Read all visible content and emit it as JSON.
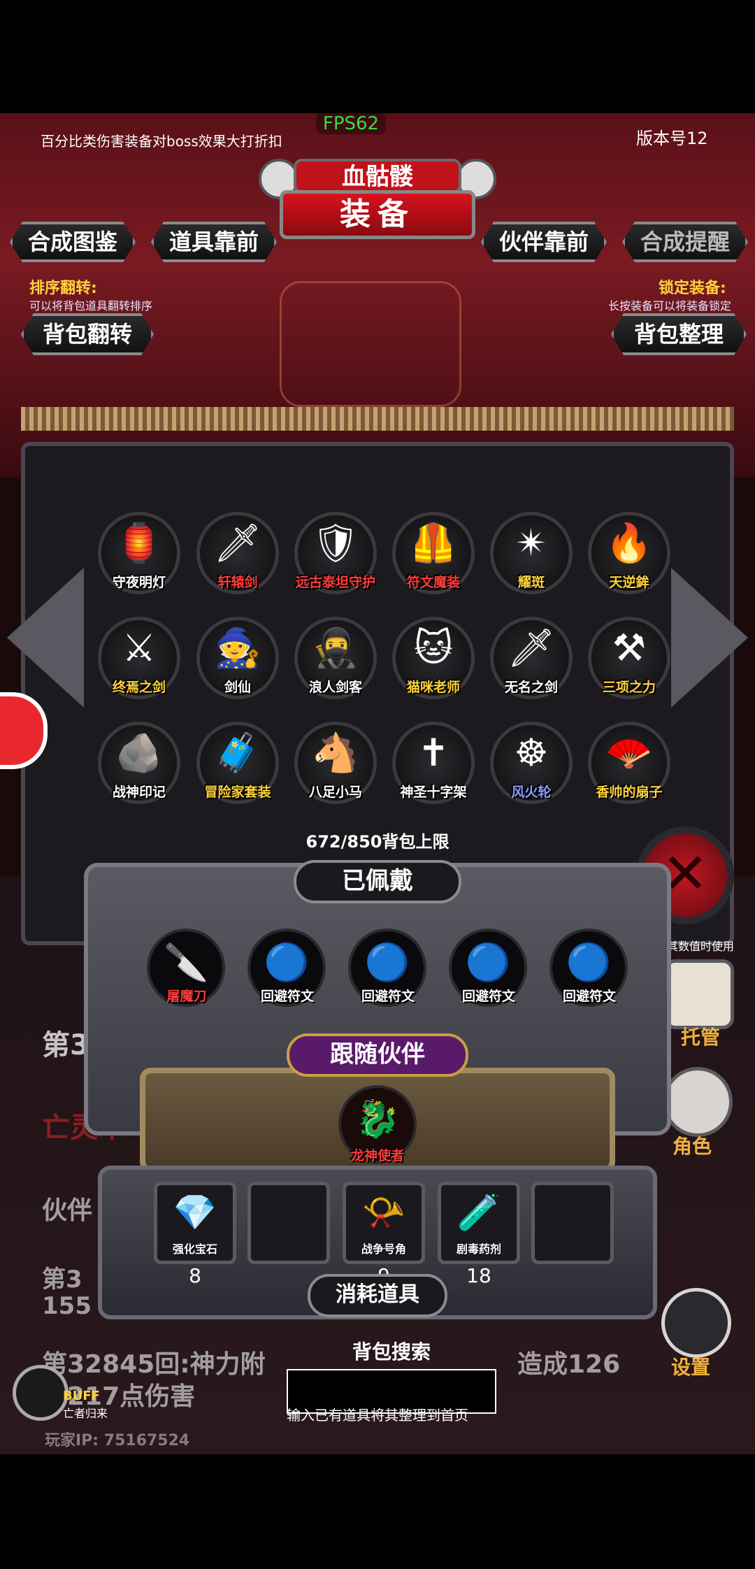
{
  "status_bar": {
    "notice": "百分比类伤害装备对boss效果大打折扣",
    "fps": "FPS62",
    "version": "版本号12"
  },
  "header": {
    "subtitle": "血骷髅",
    "title": "装备"
  },
  "tabs": {
    "synthesis_catalog": "合成图鉴",
    "items_first": "道具靠前",
    "partner_first": "伙伴靠前",
    "synthesis_hint": "合成提醒"
  },
  "controls": {
    "sort_flip_title": "排序翻转:",
    "sort_flip_desc": "可以将背包道具翻转排序",
    "bag_flip_button": "背包翻转",
    "lock_title": "锁定装备:",
    "lock_desc": "长按装备可以将装备锁定",
    "bag_sort_button": "背包整理"
  },
  "inventory": {
    "items": [
      {
        "label": "守夜明灯",
        "color": "#ffffff",
        "icon": "lantern-icon",
        "glyph": "🏮"
      },
      {
        "label": "轩辕剑",
        "color": "#ff3a3a",
        "icon": "sword-icon",
        "glyph": "🗡"
      },
      {
        "label": "远古泰坦守护",
        "color": "#ff3a3a",
        "icon": "titan-icon",
        "glyph": "🛡"
      },
      {
        "label": "符文魔装",
        "color": "#ff3a3a",
        "icon": "rune-armor-icon",
        "glyph": "🦺"
      },
      {
        "label": "耀斑",
        "color": "#ffd23a",
        "icon": "flare-icon",
        "glyph": "✴"
      },
      {
        "label": "天逆鉾",
        "color": "#ffd23a",
        "icon": "spear-icon",
        "glyph": "🔥"
      },
      {
        "label": "终焉之剑",
        "color": "#ffd23a",
        "icon": "finale-sword-icon",
        "glyph": "⚔"
      },
      {
        "label": "剑仙",
        "color": "#ffffff",
        "icon": "sword-immortal-icon",
        "glyph": "🧙"
      },
      {
        "label": "浪人剑客",
        "color": "#ffffff",
        "icon": "ronin-icon",
        "glyph": "🥷"
      },
      {
        "label": "猫咪老师",
        "color": "#ffd23a",
        "icon": "cat-teacher-icon",
        "glyph": "🐱"
      },
      {
        "label": "无名之剑",
        "color": "#ffffff",
        "icon": "nameless-sword-icon",
        "glyph": "🗡"
      },
      {
        "label": "三项之力",
        "color": "#ffd23a",
        "icon": "triforce-icon",
        "glyph": "⚒"
      },
      {
        "label": "战神印记",
        "color": "#ffffff",
        "icon": "war-god-mark-icon",
        "glyph": "🪨"
      },
      {
        "label": "冒险家套装",
        "color": "#ffd23a",
        "icon": "adventurer-icon",
        "glyph": "🧳"
      },
      {
        "label": "八足小马",
        "color": "#ffffff",
        "icon": "horse-icon",
        "glyph": "🐴"
      },
      {
        "label": "神圣十字架",
        "color": "#ffffff",
        "icon": "cross-icon",
        "glyph": "✝"
      },
      {
        "label": "风火轮",
        "color": "#8a9aff",
        "icon": "wind-fire-wheel-icon",
        "glyph": "☸"
      },
      {
        "label": "香帅的扇子",
        "color": "#ffd23a",
        "icon": "fan-icon",
        "glyph": "🪭"
      }
    ],
    "capacity": "672/850背包上限"
  },
  "equipped": {
    "title": "已佩戴",
    "slots": [
      {
        "label": "屠魔刀",
        "color": "#ff3a3a",
        "icon": "blade-icon",
        "glyph": "🔪"
      },
      {
        "label": "回避符文",
        "color": "#ffffff",
        "icon": "evasion-rune-icon",
        "glyph": "🔵"
      },
      {
        "label": "回避符文",
        "color": "#ffffff",
        "icon": "evasion-rune-icon",
        "glyph": "🔵"
      },
      {
        "label": "回避符文",
        "color": "#ffffff",
        "icon": "evasion-rune-icon",
        "glyph": "🔵"
      },
      {
        "label": "回避符文",
        "color": "#ffffff",
        "icon": "evasion-rune-icon",
        "glyph": "🔵"
      }
    ]
  },
  "partner": {
    "title": "跟随伙伴",
    "name": "龙神使者",
    "glyph": "🐉"
  },
  "consumables": {
    "title": "消耗道具",
    "items": [
      {
        "label": "强化宝石",
        "count": "8",
        "icon": "gem-icon",
        "glyph": "💎"
      },
      {
        "label": "",
        "count": "",
        "icon": "",
        "glyph": ""
      },
      {
        "label": "战争号角",
        "count": "9",
        "icon": "horn-icon",
        "glyph": "📯"
      },
      {
        "label": "剧毒药剂",
        "count": "18",
        "icon": "poison-icon",
        "glyph": "🧪"
      },
      {
        "label": "",
        "count": "",
        "icon": "",
        "glyph": ""
      }
    ]
  },
  "search": {
    "title": "背包搜索",
    "value": "",
    "hint": "输入已有道具将其整理到首页"
  },
  "side": {
    "hint": "其数值时使用",
    "role_label": "角色",
    "settings_label": "设置",
    "manage_label": "托管"
  },
  "background_log": {
    "line1": "第3",
    "line2": "亡灵术",
    "line3": "伙伴",
    "line4": "第3",
    "line5": "155",
    "line6": "第32845回:神力附",
    "line7": "造成126",
    "line8": "217点伤害",
    "buff": "BUFF",
    "buff_name": "亡者归来"
  },
  "player_ip": "玩家IP:  75167524"
}
